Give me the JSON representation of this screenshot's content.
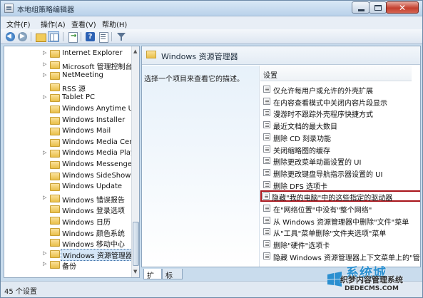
{
  "window": {
    "title": "本地组策略编辑器",
    "min_label": "",
    "close_label": "✕"
  },
  "menu": [
    "文件(F)",
    "操作(A)",
    "查看(V)",
    "帮助(H)"
  ],
  "toolbar": {
    "icons": [
      "back-icon",
      "forward-icon",
      "up-folder-icon",
      "show-hide-tree-icon",
      "export-list-icon",
      "help-icon",
      "properties-icon",
      "filter-icon"
    ]
  },
  "tree": {
    "items": [
      {
        "label": "Internet Explorer",
        "expandable": true,
        "selected": false
      },
      {
        "label": "Microsoft 管理控制台",
        "expandable": true,
        "selected": false
      },
      {
        "label": "NetMeeting",
        "expandable": true,
        "selected": false
      },
      {
        "label": "RSS 源",
        "expandable": false,
        "selected": false
      },
      {
        "label": "Tablet PC",
        "expandable": true,
        "selected": false
      },
      {
        "label": "Windows Anytime Up",
        "expandable": false,
        "selected": false
      },
      {
        "label": "Windows Installer",
        "expandable": false,
        "selected": false
      },
      {
        "label": "Windows Mail",
        "expandable": false,
        "selected": false
      },
      {
        "label": "Windows Media Cent",
        "expandable": false,
        "selected": false
      },
      {
        "label": "Windows Media Play",
        "expandable": true,
        "selected": false
      },
      {
        "label": "Windows Messenger",
        "expandable": false,
        "selected": false
      },
      {
        "label": "Windows SideShow",
        "expandable": false,
        "selected": false
      },
      {
        "label": "Windows Update",
        "expandable": false,
        "selected": false
      },
      {
        "label": "Windows 错误报告",
        "expandable": true,
        "selected": false
      },
      {
        "label": "Windows 登录选项",
        "expandable": false,
        "selected": false
      },
      {
        "label": "Windows 日历",
        "expandable": false,
        "selected": false
      },
      {
        "label": "Windows 颜色系统",
        "expandable": false,
        "selected": false
      },
      {
        "label": "Windows 移动中心",
        "expandable": false,
        "selected": false
      },
      {
        "label": "Windows 资源管理器",
        "expandable": true,
        "selected": true
      },
      {
        "label": "备份",
        "expandable": true,
        "selected": false
      }
    ]
  },
  "right_pane": {
    "header_title": "Windows 资源管理器",
    "description_prompt": "选择一个项目来查看它的描述。",
    "column_header": "设置",
    "settings": [
      {
        "label": "仅允许每用户或允许的外壳扩展",
        "highlighted": false
      },
      {
        "label": "在内容查看模式中关闭内容片段显示",
        "highlighted": false
      },
      {
        "label": "漫游时不跟踪外壳程序快捷方式",
        "highlighted": false
      },
      {
        "label": "最近文档的最大数目",
        "highlighted": false
      },
      {
        "label": "删除 CD 刻录功能",
        "highlighted": false
      },
      {
        "label": "关闭缩略图的缓存",
        "highlighted": false
      },
      {
        "label": "删除更改菜单动画设置的 UI",
        "highlighted": false
      },
      {
        "label": "删除更改键盘导航指示器设置的 UI",
        "highlighted": false
      },
      {
        "label": "删除 DFS 选项卡",
        "highlighted": false
      },
      {
        "label": "隐藏\"我的电脑\"中的这些指定的驱动器",
        "highlighted": true
      },
      {
        "label": "在\"网络位置\"中没有\"整个网络\"",
        "highlighted": false
      },
      {
        "label": "从 Windows 资源管理器中删除\"文件\"菜单",
        "highlighted": false
      },
      {
        "label": "从\"工具\"菜单删除\"文件夹选项\"菜单",
        "highlighted": false
      },
      {
        "label": "删除\"硬件\"选项卡",
        "highlighted": false
      },
      {
        "label": "隐藏 Windows 资源管理器上下文菜单上的\"管",
        "highlighted": false
      }
    ]
  },
  "tabs": [
    "扩展",
    "标准"
  ],
  "status": {
    "text": "45 个设置"
  },
  "watermark": {
    "brand": "系统城",
    "line1": "织梦内容管理系统",
    "line2": "DEDECMS.COM"
  },
  "colors": {
    "highlight_border": "#a8141b",
    "selection": "#d5e6f7",
    "window_frame": "#c9dced"
  }
}
